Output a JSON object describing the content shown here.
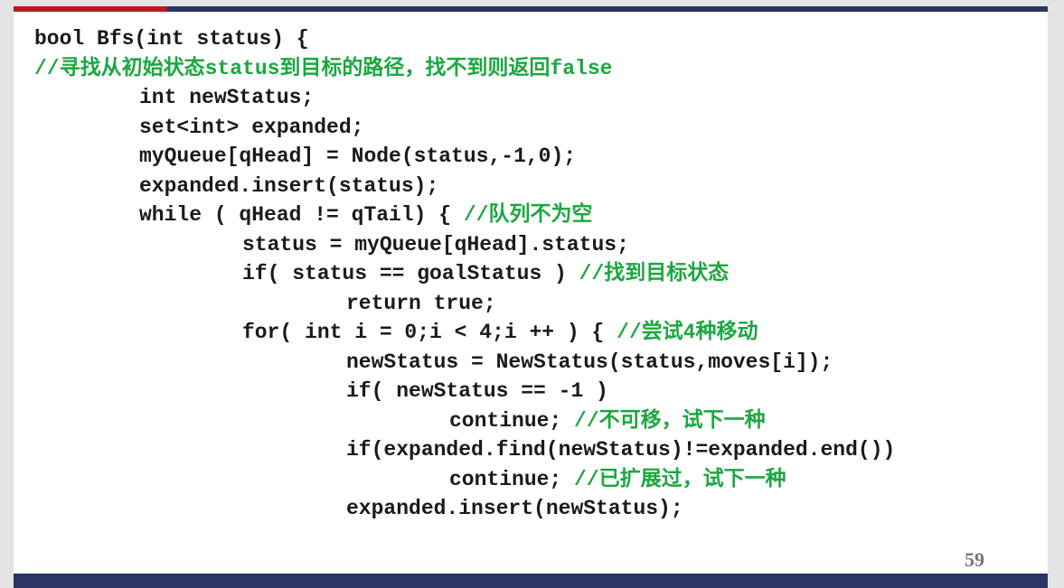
{
  "colors": {
    "accent_red": "#c0181e",
    "navy": "#2a3466",
    "comment_green": "#1aa83f",
    "code_text": "#1a1a1a",
    "page_number_gray": "#777777"
  },
  "code_lines": [
    {
      "indent": 0,
      "code": "bool Bfs(int status) {",
      "comment": ""
    },
    {
      "indent": 0,
      "code": "",
      "comment": "//寻找从初始状态status到目标的路径，找不到则返回false"
    },
    {
      "indent": 1,
      "code": "int newStatus;",
      "comment": ""
    },
    {
      "indent": 1,
      "code": "set<int> expanded;",
      "comment": ""
    },
    {
      "indent": 1,
      "code": "myQueue[qHead] = Node(status,-1,0);",
      "comment": ""
    },
    {
      "indent": 1,
      "code": "expanded.insert(status);",
      "comment": ""
    },
    {
      "indent": 1,
      "code": "while ( qHead != qTail) { ",
      "comment": "//队列不为空"
    },
    {
      "indent": 2,
      "code": "status = myQueue[qHead].status;",
      "comment": ""
    },
    {
      "indent": 2,
      "code": "if( status == goalStatus ) ",
      "comment": "//找到目标状态"
    },
    {
      "indent": 3,
      "code": "return true;",
      "comment": ""
    },
    {
      "indent": 2,
      "code": "for( int i = 0;i < 4;i ++ ) { ",
      "comment": "//尝试4种移动"
    },
    {
      "indent": 3,
      "code": "newStatus = NewStatus(status,moves[i]);",
      "comment": ""
    },
    {
      "indent": 3,
      "code": "if( newStatus == -1 )",
      "comment": ""
    },
    {
      "indent": 4,
      "code": "continue; ",
      "comment": "//不可移，试下一种"
    },
    {
      "indent": 3,
      "code": "if(expanded.find(newStatus)!=expanded.end())",
      "comment": ""
    },
    {
      "indent": 4,
      "code": "continue; ",
      "comment": "//已扩展过，试下一种"
    },
    {
      "indent": 3,
      "code": "expanded.insert(newStatus);",
      "comment": ""
    }
  ],
  "page_number": "59"
}
